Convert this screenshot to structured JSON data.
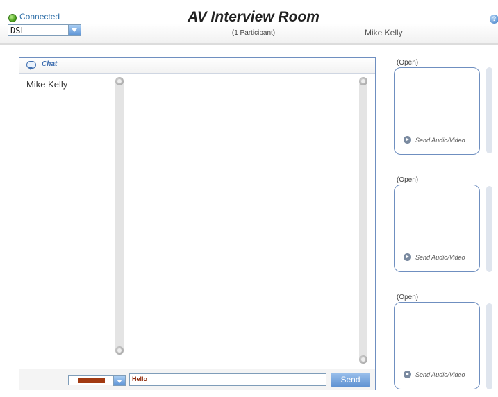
{
  "header": {
    "status": "Connected",
    "connection": {
      "selected": "DSL"
    },
    "title": "AV Interview Room",
    "participants": "(1 Participant)",
    "user": "Mike Kelly",
    "help": "?"
  },
  "chat": {
    "title": "Chat",
    "people": [
      "Mike Kelly"
    ],
    "messages": [],
    "text_color": "#a23a12",
    "input_value": "Hello",
    "send_label": "Send"
  },
  "video_slots": [
    {
      "label": "(Open)",
      "action": "Send Audio/Video"
    },
    {
      "label": "(Open)",
      "action": "Send Audio/Video"
    },
    {
      "label": "(Open)",
      "action": "Send Audio/Video"
    }
  ],
  "colors": {
    "accent": "#3f6fb0",
    "border": "#6f8fc0",
    "status_green": "#4fa41f"
  }
}
